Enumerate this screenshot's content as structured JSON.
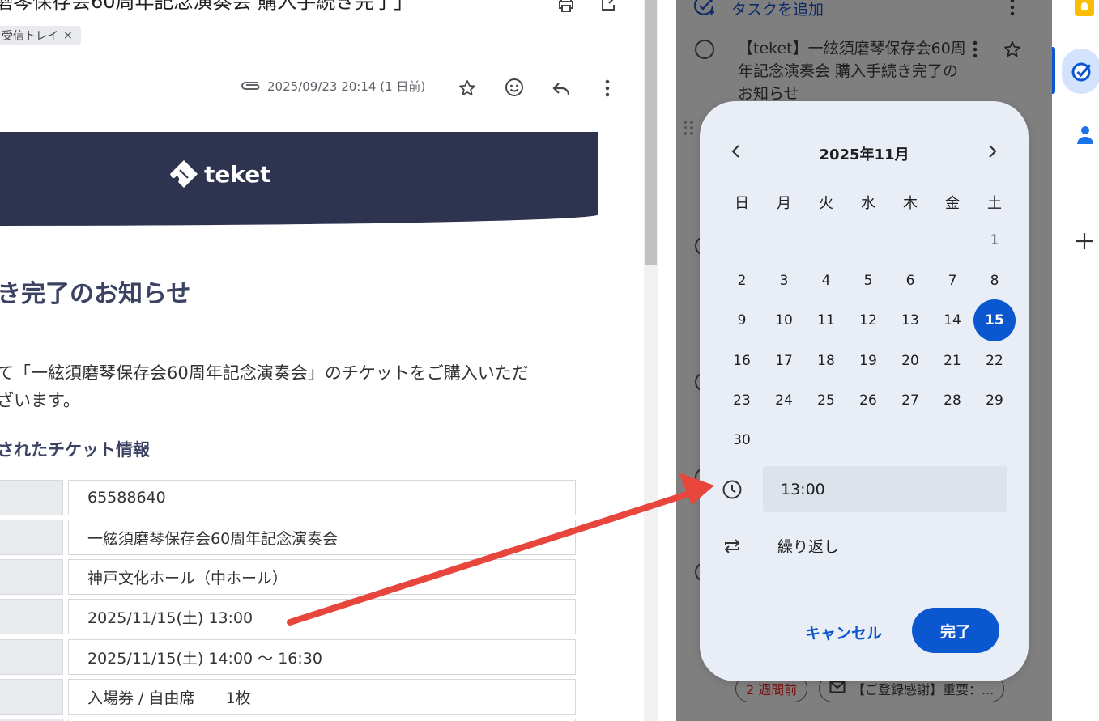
{
  "email": {
    "subject": "磨琴保存会60周年記念演奏会 購入手続き完了」",
    "label_chip": "受信トレイ",
    "label_chip_close": "×",
    "date": "2025/09/23 20:14 (1 日前)",
    "brand": "teket",
    "heading": "き完了のお知らせ",
    "body_line1": "て「一絃須磨琴保存会60周年記念演奏会」のチケットをご購入いただ",
    "body_line2": "ざいます。",
    "section_heading": "されたチケット情報",
    "table_values": [
      "65588640",
      "一絃須磨琴保存会60周年記念演奏会",
      "神戸文化ホール（中ホール）",
      "2025/11/15(土) 13:00",
      "2025/11/15(土) 14:00 ～ 16:30",
      "入場券 / 自由席　　1枚"
    ]
  },
  "tasks": {
    "add_task_label": "タスクを追加",
    "task_title": "【teket】一絃須磨琴保存会60周年記念演奏会 購入手続き完了のお知らせ",
    "chip_time": "2 週間前",
    "chip_mail": "【ご登録感謝】重要：..."
  },
  "picker": {
    "month_title": "2025年11月",
    "weekdays": [
      "日",
      "月",
      "火",
      "水",
      "木",
      "金",
      "土"
    ],
    "first_weekday_index": 6,
    "days_in_month": 30,
    "selected_day": 15,
    "time_value": "13:00",
    "repeat_label": "繰り返し",
    "cancel_label": "キャンセル",
    "done_label": "完了"
  },
  "colors": {
    "accent": "#0b57d0",
    "banner": "#2e3450",
    "arrow": "#e8453c",
    "overlay": "#7f7f7f"
  },
  "icons": [
    "print-icon",
    "open-in-new-icon",
    "attachment-icon",
    "star-icon",
    "emoji-icon",
    "reply-icon",
    "more-vert-icon",
    "add-task-icon",
    "chevron-left-icon",
    "chevron-right-icon",
    "clock-icon",
    "repeat-icon",
    "mail-icon",
    "keep-icon",
    "tasks-icon",
    "contacts-icon",
    "plus-icon"
  ]
}
